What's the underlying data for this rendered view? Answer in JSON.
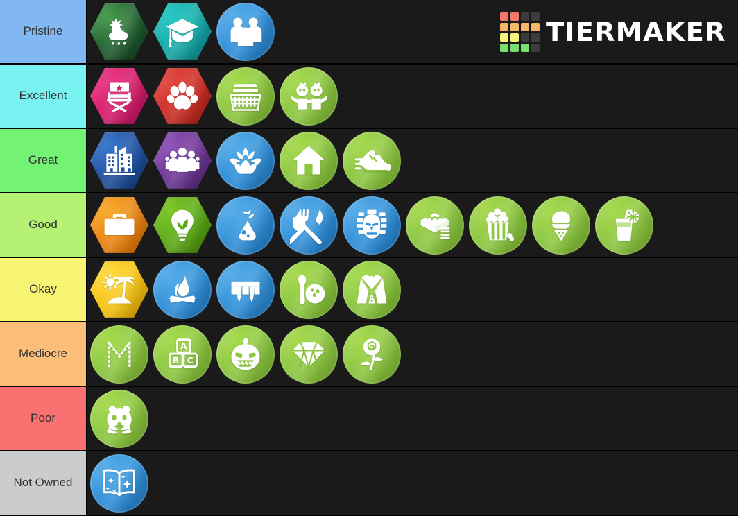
{
  "app": {
    "name": "TierMaker",
    "logo_text": "TiERMAKER",
    "logo_grid_colors": [
      "#f4796b",
      "#f4796b",
      "#3c3c3c",
      "#3c3c3c",
      "#f6b868",
      "#f6b868",
      "#f6b868",
      "#f6b868",
      "#f8f479",
      "#f8f479",
      "#3c3c3c",
      "#3c3c3c",
      "#78e06c",
      "#78e06c",
      "#78e06c",
      "#3c3c3c"
    ],
    "background_color": "#1a1a1a"
  },
  "tiers": [
    {
      "label": "Pristine",
      "color": "#81b8f4",
      "items": [
        {
          "name": "seasons",
          "shape": "hex",
          "icon": "weather-sun-cloud-rain-icon",
          "color1": "#1e5c2e",
          "color2": "#3f9b46",
          "color3": "#12351c"
        },
        {
          "name": "discover-university",
          "shape": "hex",
          "icon": "graduation-cap-icon",
          "color1": "#13a8a8",
          "color2": "#1ec6c0",
          "color3": "#0b7c80"
        },
        {
          "name": "parenthood",
          "shape": "circle",
          "icon": "family-group-icon",
          "color1": "#2f8fd8",
          "color2": "#4ea9e8",
          "color3": "#1f72b8"
        }
      ]
    },
    {
      "label": "Excellent",
      "color": "#79f2f2",
      "items": [
        {
          "name": "get-famous",
          "shape": "hex",
          "icon": "director-chair-icon",
          "color1": "#d61a6a",
          "color2": "#e8307f",
          "color3": "#a61254"
        },
        {
          "name": "cats-and-dogs",
          "shape": "hex",
          "icon": "paw-print-icon",
          "color1": "#cc2b24",
          "color2": "#e04038",
          "color3": "#99201c"
        },
        {
          "name": "laundry-day",
          "shape": "circle",
          "icon": "laundry-basket-icon",
          "color1": "#8cc63f",
          "color2": "#a2d846",
          "color3": "#75ad2e"
        },
        {
          "name": "toddler-stuff",
          "shape": "circle",
          "icon": "two-toddlers-icon",
          "color1": "#8cc63f",
          "color2": "#a2d846",
          "color3": "#75ad2e"
        }
      ]
    },
    {
      "label": "Great",
      "color": "#74f274",
      "items": [
        {
          "name": "city-living",
          "shape": "hex",
          "icon": "city-buildings-icon",
          "color1": "#1d4f9e",
          "color2": "#2f71c9",
          "color3": "#143a77"
        },
        {
          "name": "get-together",
          "shape": "hex",
          "icon": "people-group-icon",
          "color1": "#6a3592",
          "color2": "#8b4bb5",
          "color3": "#4d2470"
        },
        {
          "name": "spa-day",
          "shape": "circle",
          "icon": "lotus-flower-icon",
          "color1": "#2f8fd8",
          "color2": "#4ea9e8",
          "color3": "#1f72b8"
        },
        {
          "name": "tiny-living",
          "shape": "circle",
          "icon": "house-icon",
          "color1": "#8cc63f",
          "color2": "#a2d846",
          "color3": "#75ad2e"
        },
        {
          "name": "fitness-stuff",
          "shape": "circle",
          "icon": "running-shoe-icon",
          "color1": "#8cc63f",
          "color2": "#a2d846",
          "color3": "#75ad2e"
        }
      ]
    },
    {
      "label": "Good",
      "color": "#b5f274",
      "items": [
        {
          "name": "get-to-work",
          "shape": "hex",
          "icon": "briefcase-icon",
          "color1": "#e8820f",
          "color2": "#f9a825",
          "color3": "#c26505"
        },
        {
          "name": "eco-lifestyle",
          "shape": "hex",
          "icon": "eco-lightbulb-icon",
          "color1": "#5aa814",
          "color2": "#76c41e",
          "color3": "#3f7d0c"
        },
        {
          "name": "discover-science",
          "shape": "circle",
          "icon": "flask-icon",
          "color1": "#2f8fd8",
          "color2": "#4ea9e8",
          "color3": "#1f72b8"
        },
        {
          "name": "dine-out",
          "shape": "circle",
          "icon": "fork-knife-icon",
          "color1": "#2f8fd8",
          "color2": "#4ea9e8",
          "color3": "#1f72b8"
        },
        {
          "name": "jungle-adventure",
          "shape": "circle",
          "icon": "tiki-mask-icon",
          "color1": "#2f8fd8",
          "color2": "#4ea9e8",
          "color3": "#1f72b8"
        },
        {
          "name": "bakery-stuff",
          "shape": "circle",
          "icon": "cake-stand-icon",
          "color1": "#8cc63f",
          "color2": "#a2d846",
          "color3": "#75ad2e"
        },
        {
          "name": "movie-hangout",
          "shape": "circle",
          "icon": "popcorn-icon",
          "color1": "#8cc63f",
          "color2": "#a2d846",
          "color3": "#75ad2e"
        },
        {
          "name": "cool-kitchen",
          "shape": "circle",
          "icon": "ice-cream-cone-icon",
          "color1": "#8cc63f",
          "color2": "#a2d846",
          "color3": "#75ad2e"
        },
        {
          "name": "backyard-drinks",
          "shape": "circle",
          "icon": "drink-glass-icon",
          "color1": "#8cc63f",
          "color2": "#a2d846",
          "color3": "#75ad2e"
        }
      ]
    },
    {
      "label": "Okay",
      "color": "#f8f474",
      "items": [
        {
          "name": "island-living",
          "shape": "hex",
          "icon": "island-palm-sun-icon",
          "color1": "#f5c211",
          "color2": "#ffd93a",
          "color3": "#d19a00"
        },
        {
          "name": "outdoor-retreat",
          "shape": "circle",
          "icon": "campfire-icon",
          "color1": "#2f8fd8",
          "color2": "#4ea9e8",
          "color3": "#1f72b8"
        },
        {
          "name": "vampires",
          "shape": "circle",
          "icon": "vampire-fangs-icon",
          "color1": "#2f8fd8",
          "color2": "#4ea9e8",
          "color3": "#1f72b8"
        },
        {
          "name": "bowling-night",
          "shape": "circle",
          "icon": "bowling-pin-ball-icon",
          "color1": "#8cc63f",
          "color2": "#a2d846",
          "color3": "#75ad2e"
        },
        {
          "name": "vintage-glamour",
          "shape": "circle",
          "icon": "tuxedo-icon",
          "color1": "#8cc63f",
          "color2": "#a2d846",
          "color3": "#75ad2e"
        }
      ]
    },
    {
      "label": "Mediocre",
      "color": "#fbbe79",
      "items": [
        {
          "name": "moschino-stuff",
          "shape": "circle",
          "icon": "chain-letter-m-icon",
          "color1": "#8cc63f",
          "color2": "#a2d846",
          "color3": "#75ad2e"
        },
        {
          "name": "nursery-stuff",
          "shape": "circle",
          "icon": "abc-blocks-icon",
          "color1": "#8cc63f",
          "color2": "#a2d846",
          "color3": "#75ad2e"
        },
        {
          "name": "spooky-stuff",
          "shape": "circle",
          "icon": "pumpkin-icon",
          "color1": "#8cc63f",
          "color2": "#a2d846",
          "color3": "#75ad2e"
        },
        {
          "name": "luxury-party",
          "shape": "circle",
          "icon": "diamond-icon",
          "color1": "#8cc63f",
          "color2": "#a2d846",
          "color3": "#75ad2e"
        },
        {
          "name": "romantic-garden",
          "shape": "circle",
          "icon": "rose-icon",
          "color1": "#8cc63f",
          "color2": "#a2d846",
          "color3": "#75ad2e"
        }
      ]
    },
    {
      "label": "Poor",
      "color": "#fa7171",
      "items": [
        {
          "name": "my-first-pet",
          "shape": "circle",
          "icon": "hamster-face-icon",
          "color1": "#8cc63f",
          "color2": "#a2d846",
          "color3": "#75ad2e"
        }
      ]
    },
    {
      "label": "Not Owned",
      "color": "#cccccc",
      "items": [
        {
          "name": "realm-of-magic",
          "shape": "circle",
          "icon": "magic-book-icon",
          "color1": "#2f8fd8",
          "color2": "#4ea9e8",
          "color3": "#1f72b8"
        }
      ]
    }
  ]
}
